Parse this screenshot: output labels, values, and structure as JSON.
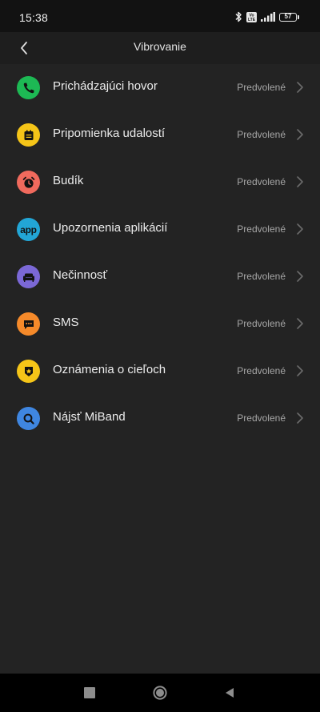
{
  "status_bar": {
    "time": "15:38",
    "net_label": "Vo LTE",
    "battery": "57",
    "icons": [
      "bluetooth-icon",
      "volte-icon",
      "signal-icon",
      "battery-icon"
    ]
  },
  "header": {
    "title": "Vibrovanie",
    "back_icon": "chevron-left-icon"
  },
  "items": [
    {
      "id": "incoming-call",
      "label": "Prichádzajúci hovor",
      "value": "Predvolené",
      "icon": "phone-icon",
      "color": "#1db954"
    },
    {
      "id": "event-reminder",
      "label": "Pripomienka udalostí",
      "value": "Predvolené",
      "icon": "calendar-icon",
      "color": "#f5c518"
    },
    {
      "id": "alarm",
      "label": "Budík",
      "value": "Predvolené",
      "icon": "alarm-clock-icon",
      "color": "#f06a5d"
    },
    {
      "id": "app-notifications",
      "label": "Upozornenia aplikácií",
      "value": "Predvolené",
      "icon": "app-icon",
      "icon_text": "app",
      "color": "#22a6d6"
    },
    {
      "id": "idle",
      "label": "Nečinnosť",
      "value": "Predvolené",
      "icon": "sofa-icon",
      "color": "#7b68d6"
    },
    {
      "id": "sms",
      "label": "SMS",
      "value": "Predvolené",
      "icon": "message-icon",
      "color": "#f58a2a"
    },
    {
      "id": "goal-notifications",
      "label": "Oznámenia o cieľoch",
      "value": "Predvolené",
      "icon": "badge-star-icon",
      "color": "#f5c518"
    },
    {
      "id": "find-miband",
      "label": "Nájsť MiBand",
      "value": "Predvolené",
      "icon": "search-icon",
      "color": "#3f86e0"
    }
  ],
  "nav_bar": {
    "icons": [
      "recents-square-icon",
      "home-circle-icon",
      "back-triangle-icon"
    ]
  }
}
